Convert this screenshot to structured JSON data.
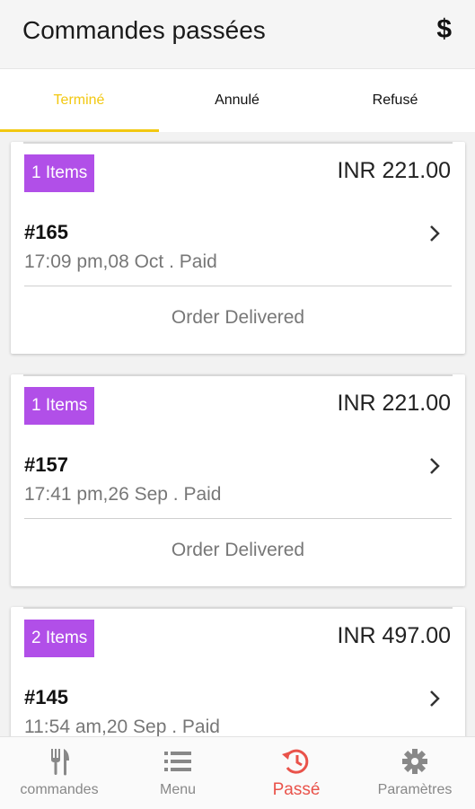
{
  "header": {
    "title": "Commandes passées",
    "currency_symbol": "$"
  },
  "tabs": [
    {
      "label": "Terminé",
      "active": true
    },
    {
      "label": "Annulé",
      "active": false
    },
    {
      "label": "Refusé",
      "active": false
    }
  ],
  "orders": [
    {
      "items": "1 Items",
      "price": "INR 221.00",
      "id": "#165",
      "meta": "17:09 pm,08 Oct . Paid",
      "status": "Order Delivered"
    },
    {
      "items": "1 Items",
      "price": "INR 221.00",
      "id": "#157",
      "meta": "17:41 pm,26 Sep . Paid",
      "status": "Order Delivered"
    },
    {
      "items": "2 Items",
      "price": "INR 497.00",
      "id": "#145",
      "meta": "11:54 am,20 Sep . Paid",
      "status": ""
    }
  ],
  "bottom_nav": [
    {
      "label": "commandes",
      "icon": "cutlery-icon",
      "active": false
    },
    {
      "label": "Menu",
      "icon": "list-icon",
      "active": false
    },
    {
      "label": "Passé",
      "icon": "history-icon",
      "active": true
    },
    {
      "label": "Paramètres",
      "icon": "gear-icon",
      "active": false
    }
  ],
  "colors": {
    "accent": "#f2c811",
    "badge": "#b14fe8",
    "active_nav": "#e9524a"
  }
}
